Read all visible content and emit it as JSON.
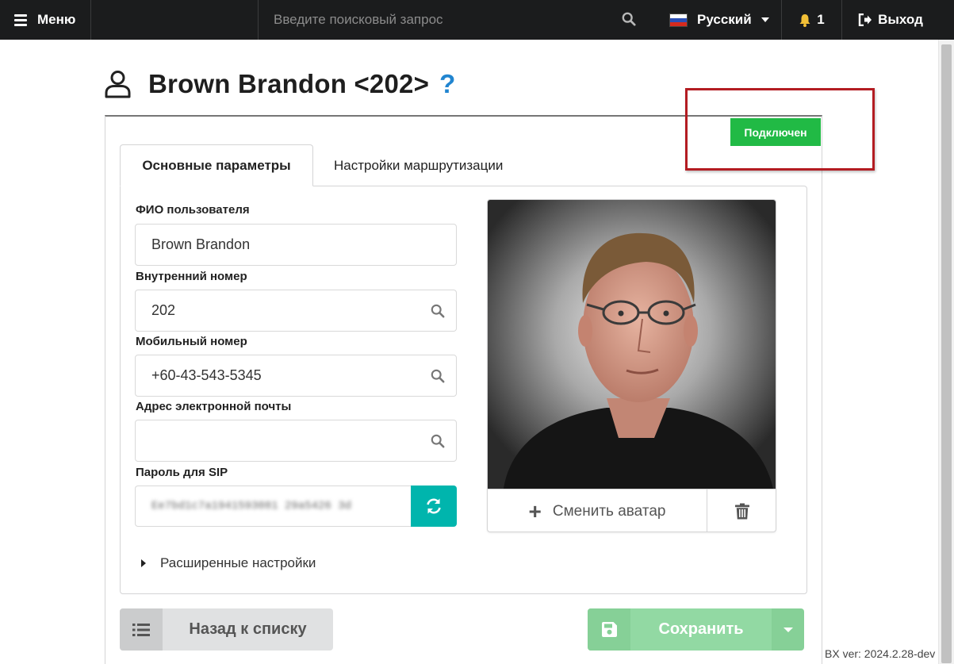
{
  "topbar": {
    "menu_label": "Меню",
    "search_placeholder": "Введите поисковый запрос",
    "language": "Русский",
    "notifications_count": "1",
    "logout_label": "Выход"
  },
  "page": {
    "title": "Brown Brandon <202>",
    "help": "?",
    "status": "Подключен",
    "status_color": "#21ba45"
  },
  "tabs": [
    {
      "label": "Основные параметры",
      "active": true
    },
    {
      "label": "Настройки маршрутизации",
      "active": false
    }
  ],
  "form": {
    "fio": {
      "label": "ФИО пользователя",
      "value": "Brown Brandon"
    },
    "extension": {
      "label": "Внутренний номер",
      "value": "202"
    },
    "mobile": {
      "label": "Мобильный номер",
      "value": "+60-43-543-5345"
    },
    "email": {
      "label": "Адрес электронной почты",
      "value": ""
    },
    "sip_password": {
      "label": "Пароль для SIP",
      "value": "Ee7bd1c7a1941593081 29a5426 3d"
    },
    "advanced_label": "Расширенные настройки"
  },
  "avatar": {
    "change_label": "Сменить аватар"
  },
  "buttons": {
    "back_label": "Назад к списку",
    "save_label": "Сохранить"
  },
  "footer": {
    "version": "BX ver: 2024.2.28-dev"
  },
  "icons": [
    "hamburger-icon",
    "search-icon",
    "russian-flag-icon",
    "bell-icon",
    "sign-out-icon",
    "user-icon",
    "question-icon",
    "refresh-icon",
    "plus-icon",
    "trash-icon",
    "list-icon",
    "save-icon",
    "caret-down-icon"
  ]
}
